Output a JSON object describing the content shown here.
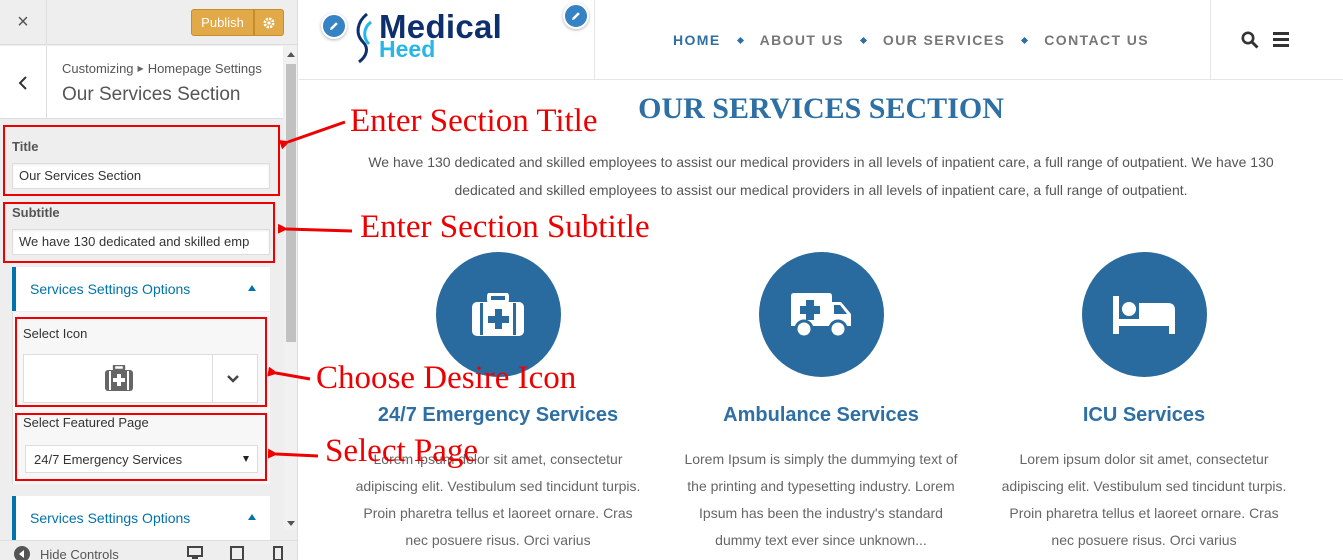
{
  "customizer": {
    "close_label": "×",
    "publish_label": "Publish",
    "breadcrumb": {
      "root": "Customizing",
      "parent": "Homepage Settings"
    },
    "section_title": "Our Services Section",
    "title_field": {
      "label": "Title",
      "value": "Our Services Section"
    },
    "subtitle_field": {
      "label": "Subtitle",
      "value": "We have 130 dedicated and skilled emp"
    },
    "accordions": [
      {
        "label": "Services Settings Options",
        "expanded": true
      },
      {
        "label": "Services Settings Options",
        "expanded": true
      }
    ],
    "select_icon": {
      "label": "Select Icon",
      "value_icon": "medkit-icon"
    },
    "featured_page": {
      "label": "Select Featured Page",
      "value": "24/7 Emergency Services"
    },
    "footer": {
      "hide_controls": "Hide Controls",
      "devices": [
        "desktop-icon",
        "tablet-icon",
        "mobile-icon"
      ]
    }
  },
  "site": {
    "logo": {
      "line1": "Medical",
      "line2": "Heed"
    },
    "nav": [
      {
        "label": "HOME",
        "active": true
      },
      {
        "label": "ABOUT US",
        "active": false
      },
      {
        "label": "OUR SERVICES",
        "active": false
      },
      {
        "label": "CONTACT US",
        "active": false
      }
    ],
    "services": {
      "heading": "OUR SERVICES SECTION",
      "subtitle": "We have 130 dedicated and skilled employees to assist our medical providers in all levels of inpatient care, a full range of outpatient. We have 130 dedicated and skilled employees to assist our medical providers in all levels of inpatient care, a full range of outpatient.",
      "cards": [
        {
          "icon": "medkit-icon",
          "title": "24/7 Emergency Services",
          "text": "Lorem ipsum dolor sit amet, consectetur adipiscing elit. Vestibulum sed tincidunt turpis. Proin pharetra tellus et laoreet ornare. Cras nec posuere risus. Orci varius"
        },
        {
          "icon": "ambulance-icon",
          "title": "Ambulance Services",
          "text": "Lorem Ipsum is simply the dummying text of the printing and typesetting industry. Lorem Ipsum has been the industry's standard dummy text ever since unknown..."
        },
        {
          "icon": "bed-icon",
          "title": "ICU Services",
          "text": "Lorem ipsum dolor sit amet, consectetur adipiscing elit. Vestibulum sed tincidunt turpis. Proin pharetra tellus et laoreet ornare. Cras nec posuere risus. Orci varius"
        }
      ]
    }
  },
  "annotations": {
    "title": "Enter Section Title",
    "subtitle": "Enter Section Subtitle",
    "icon": "Choose Desire Icon",
    "page": "Select Page",
    "color": "#e00000"
  },
  "colors": {
    "publish": "#e1a948",
    "accent": "#0073aa",
    "brand": "#2e6fa4",
    "circle": "#2a6b9f"
  }
}
